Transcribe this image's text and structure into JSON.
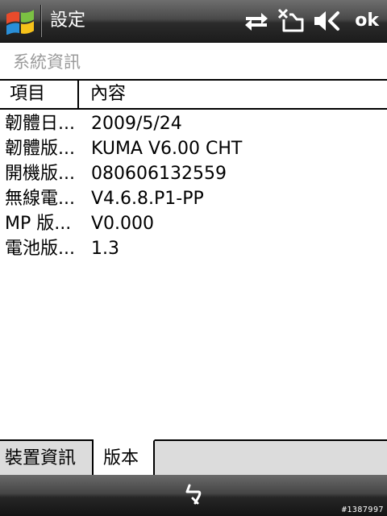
{
  "titlebar": {
    "title": "設定",
    "ok_label": "ok"
  },
  "page": {
    "title": "系統資訊"
  },
  "list": {
    "columns": [
      "項目",
      "內容"
    ],
    "rows": [
      {
        "item": "韌體日...",
        "value": "2009/5/24"
      },
      {
        "item": "韌體版...",
        "value": "KUMA V6.00 CHT"
      },
      {
        "item": "開機版...",
        "value": "080606132559"
      },
      {
        "item": "無線電...",
        "value": "V4.6.8.P1-PP"
      },
      {
        "item": "MP 版...",
        "value": "V0.000"
      },
      {
        "item": "電池版...",
        "value": "1.3"
      }
    ]
  },
  "tabs": {
    "device_info": "裝置資訊",
    "version": "版本",
    "selected": "version"
  },
  "softkeys": {
    "watermark": "#1387997"
  },
  "icons": {
    "start": "windows-flag-icon",
    "connectivity": "sync-arrows-icon",
    "signal": "no-signal-phone-icon",
    "volume": "speaker-muted-icon",
    "sip": "input-panel-icon"
  }
}
